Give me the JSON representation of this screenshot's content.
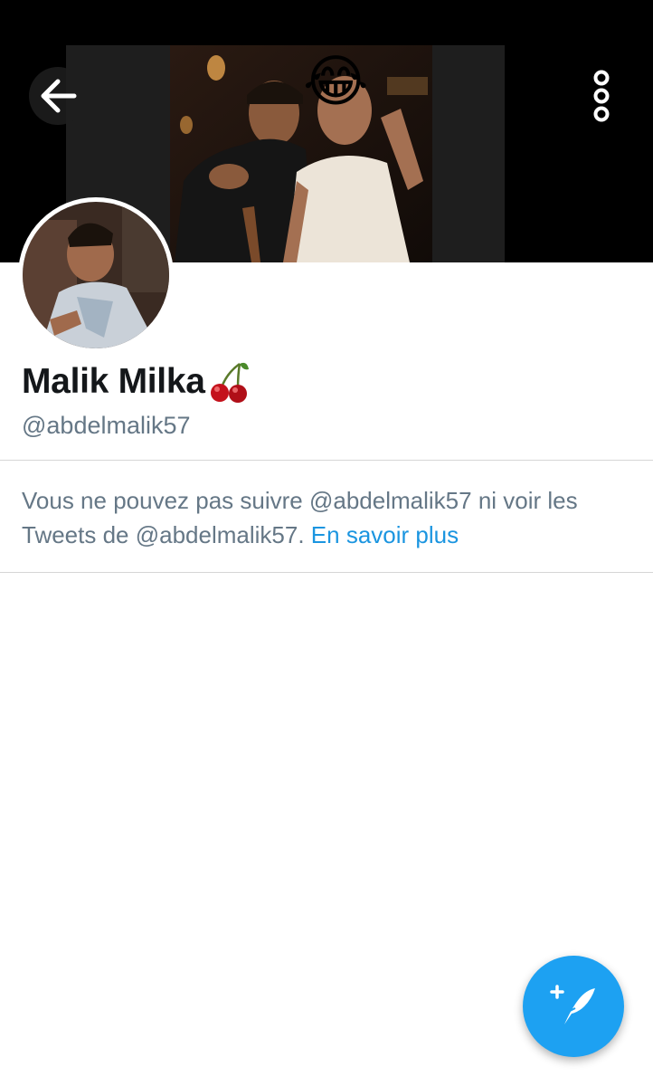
{
  "header": {
    "back_icon": "arrow-left-icon",
    "more_icon": "vertical-dots-icon",
    "banner_overlay_emoji": "😂"
  },
  "profile": {
    "name": "Malik Milka",
    "name_emoji": "🍒",
    "handle": "@abdelmalik57"
  },
  "notice": {
    "line_prefix": "Vous ne pouvez pas suivre",
    "line_mid": " @abdelmalik57 ni voir les Tweets de @abdelmalik57. ",
    "link_text": "En savoir plus"
  },
  "compose_fab": {
    "icon": "compose-tweet-icon"
  },
  "colors": {
    "accent": "#1da1f2",
    "link": "#1b95e0",
    "secondary_text": "#657786",
    "primary_text": "#14171a"
  }
}
